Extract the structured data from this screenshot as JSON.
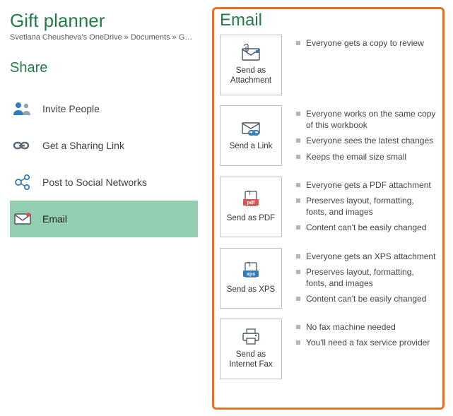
{
  "title": "Gift planner",
  "breadcrumb": "Svetlana Cheusheva's OneDrive » Documents » G…",
  "share_heading": "Share",
  "share_items": [
    {
      "label": "Invite People"
    },
    {
      "label": "Get a Sharing Link"
    },
    {
      "label": "Post to Social Networks"
    },
    {
      "label": "Email"
    }
  ],
  "panel_heading": "Email",
  "options": [
    {
      "caption": "Send as Attachment",
      "bullets": [
        "Everyone gets a copy to review"
      ]
    },
    {
      "caption": "Send a Link",
      "bullets": [
        "Everyone works on the same copy of this workbook",
        "Everyone sees the latest changes",
        "Keeps the email size small"
      ]
    },
    {
      "caption": "Send as PDF",
      "bullets": [
        "Everyone gets a PDF attachment",
        "Preserves layout, formatting, fonts, and images",
        "Content can't be easily changed"
      ]
    },
    {
      "caption": "Send as XPS",
      "bullets": [
        "Everyone gets an XPS attachment",
        "Preserves layout, formatting, fonts, and images",
        "Content can't be easily changed"
      ]
    },
    {
      "caption": "Send as Internet Fax",
      "bullets": [
        "No fax machine needed",
        "You'll need a fax service provider"
      ]
    }
  ]
}
